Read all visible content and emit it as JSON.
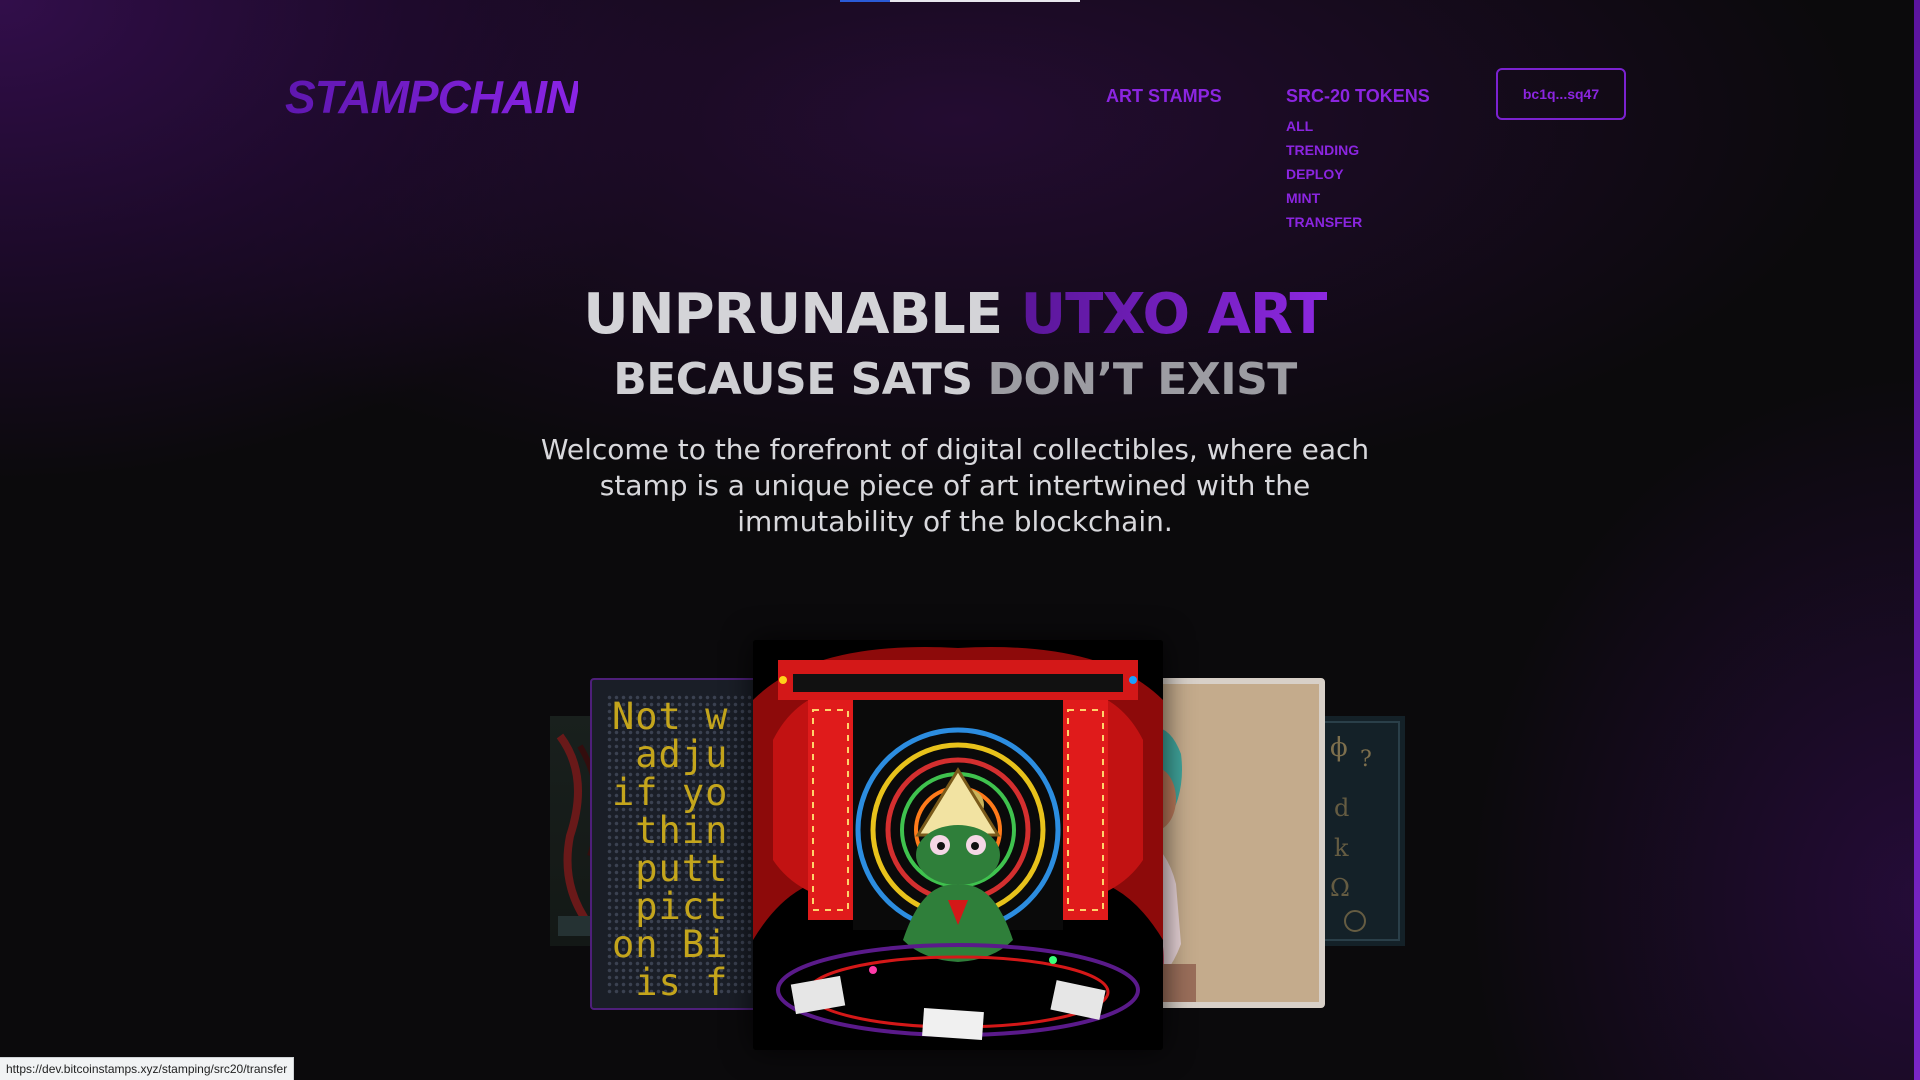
{
  "brand": {
    "logo_text": "STAMPCHAIN"
  },
  "nav": {
    "art_stamps": "ART STAMPS",
    "src20": "SRC-20 TOKENS",
    "src20_items": [
      "ALL",
      "TRENDING",
      "DEPLOY",
      "MINT",
      "TRANSFER"
    ],
    "wallet": "bc1q...sq47"
  },
  "hero": {
    "line1_a": "UNPRUNABLE ",
    "line1_b": "UTXO ART",
    "line2_a": "BECAUSE SATS ",
    "line2_b": "DON’T EXIST",
    "description": "Welcome to the forefront of digital collectibles, where each stamp is a unique piece of art intertwined with the immutability of the blockchain."
  },
  "carousel": {
    "left_card_text": "Not w\n adju\nif yo\n thin\n putt\n pict\non Bi\n is f"
  },
  "status_bar": {
    "url": "https://dev.bitcoinstamps.xyz/stamping/src20/transfer"
  },
  "colors": {
    "accent": "#8b25e0",
    "background": "#0b0a0c",
    "heading_light": "#d4d4d8"
  }
}
